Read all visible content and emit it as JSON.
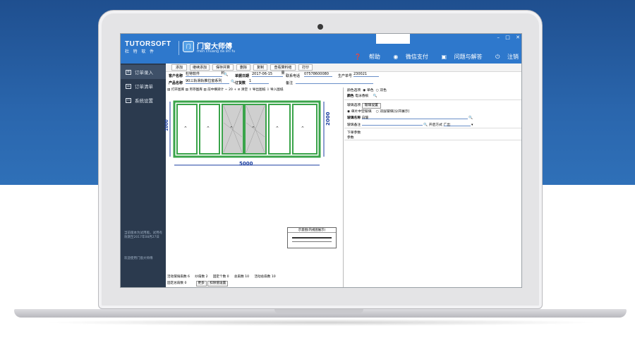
{
  "brand": {
    "name": "TUTORSOFT",
    "sub": "杜 特 软 件",
    "logo_glyph": "门",
    "product_name": "门窗大师傅",
    "product_sub": "men chuang da shi fu"
  },
  "window_controls": {
    "min": "–",
    "max": "□",
    "close": "✕"
  },
  "header_links": [
    {
      "label": "帮助",
      "icon": "help-icon"
    },
    {
      "label": "微信支付",
      "icon": "wechat-pay-icon"
    },
    {
      "label": "问题与解答",
      "icon": "faq-icon"
    },
    {
      "label": "注销",
      "icon": "power-icon"
    }
  ],
  "sidebar": {
    "items": [
      {
        "label": "订单录入",
        "icon": "order-entry-icon"
      },
      {
        "label": "订单清单",
        "icon": "order-list-icon"
      },
      {
        "label": "系统设置",
        "icon": "settings-icon"
      }
    ],
    "note": "当前版本为试用版。试用有效期至2017年08月27日",
    "welcome": "欢迎使用门窗大师傅"
  },
  "toolbar": {
    "buttons": [
      "添加",
      "继续添加",
      "保存并算料",
      "删除",
      "复制",
      "查看算料结果",
      "打印"
    ]
  },
  "form": {
    "customer_label": "客户名称",
    "customer_value": "杜特软件",
    "order_date_label": "单据日期",
    "order_date_value": "2017-06-15",
    "phone_label": "联系电话",
    "phone_value": "07578600080",
    "account_label": "生产单号",
    "account_value": "230021",
    "product_label": "产品名称",
    "product_value": "90三轨滑轨推拉窗系列",
    "order_qty_label": "订货数",
    "order_qty_value": "1",
    "remark_label": "备注"
  },
  "draw_toolbar": {
    "items": [
      "打开图库",
      "另存图库",
      "前中横梁计",
      "20",
      "清空",
      "导出图纸",
      "导入图纸"
    ]
  },
  "drawing": {
    "width_label": "5000",
    "height_label": "2000",
    "left_height_label": "1000",
    "thumb_title": "示意图(内视图展示)"
  },
  "bottom_fields": {
    "row1": [
      {
        "label": "活动玻璃扇数",
        "value": "6"
      },
      {
        "label": "纱扇数",
        "value": "2"
      },
      {
        "label": "固定个数",
        "value": "0"
      },
      {
        "label": "总扇数",
        "value": "10"
      },
      {
        "label": "活动总扇数",
        "value": "10"
      }
    ],
    "row2_label": "固定总扇数",
    "row2_value": "0",
    "more_label": "更多",
    "settings_label": "扣除值设置"
  },
  "right_panel": {
    "color_option_label": "颜色选项",
    "single_color": "单色",
    "double_color": "双色",
    "color_label": "颜色",
    "color_value": "电泳香槟",
    "glass_option_label": "玻璃选项",
    "glass_settings_btn": "玻璃设置",
    "single_glass": "单片中空玻璃",
    "double_glass": "双层玻璃(分开展示)",
    "glass_name_label": "玻璃名称",
    "glass_name_value": "白玻",
    "glass_remark_label": "玻璃备注",
    "open_method_label": "开启方式",
    "open_method_value": "广出",
    "order_params_label": "下单参数",
    "params_label": "参数"
  },
  "colors": {
    "header_blue": "#2e78cc",
    "sidebar_dark": "#2b3a4e",
    "frame_green": "#3aa44a",
    "dimension_blue": "#1b3ea0"
  }
}
